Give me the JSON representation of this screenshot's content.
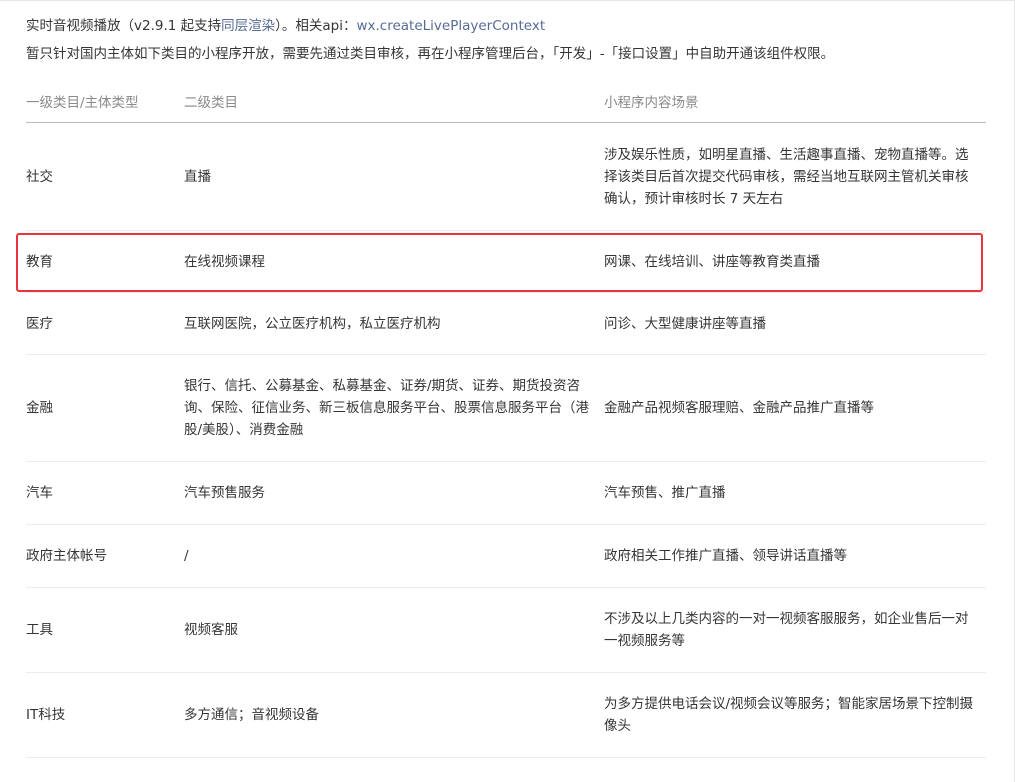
{
  "intro": {
    "prefix": "实时音视频播放（v2.9.1 起支持",
    "link1": "同层渲染",
    "middle": "）。相关api：",
    "link2": "wx.createLivePlayerContext",
    "note": "暂只针对国内主体如下类目的小程序开放，需要先通过类目审核，再在小程序管理后台，「开发」-「接口设置」中自助开通该组件权限。"
  },
  "table": {
    "headers": [
      "一级类目/主体类型",
      "二级类目",
      "小程序内容场景"
    ],
    "rows": [
      {
        "cat": "社交",
        "sub": "直播",
        "scene": "涉及娱乐性质，如明星直播、生活趣事直播、宠物直播等。选择该类目后首次提交代码审核，需经当地互联网主管机关审核确认，预计审核时长 7 天左右",
        "h": 108
      },
      {
        "cat": "教育",
        "sub": "在线视频课程",
        "scene": "网课、在线培训、讲座等教育类直播",
        "h": 62
      },
      {
        "cat": "医疗",
        "sub": "互联网医院，公立医疗机构，私立医疗机构",
        "scene": "问诊、大型健康讲座等直播",
        "h": 62
      },
      {
        "cat": "金融",
        "sub": "银行、信托、公募基金、私募基金、证券/期货、证券、期货投资咨询、保险、征信业务、新三板信息服务平台、股票信息服务平台（港股/美股）、消费金融",
        "scene": "金融产品视频客服理赔、金融产品推广直播等",
        "h": 107
      },
      {
        "cat": "汽车",
        "sub": "汽车预售服务",
        "scene": "汽车预售、推广直播",
        "h": 63
      },
      {
        "cat": "政府主体帐号",
        "sub": "/",
        "scene": "政府相关工作推广直播、领导讲话直播等",
        "h": 63
      },
      {
        "cat": "工具",
        "sub": "视频客服",
        "scene": "不涉及以上几类内容的一对一视频客服服务，如企业售后一对一视频服务等",
        "h": 85
      },
      {
        "cat": "IT科技",
        "sub": "多方通信；音视频设备",
        "scene": "为多方提供电话会议/视频会议等服务；智能家居场景下控制摄像头",
        "h": 85
      }
    ]
  },
  "highlight_color": "#e8353b"
}
